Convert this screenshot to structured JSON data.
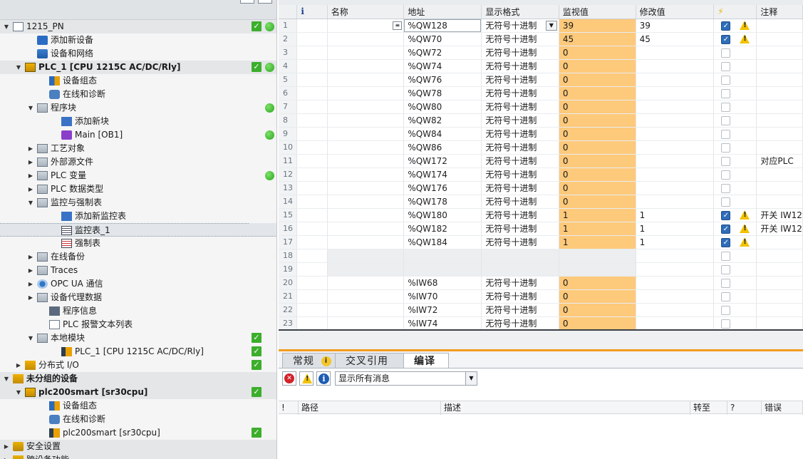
{
  "tree": {
    "rows": [
      {
        "label": "1215_PN",
        "indent": 0,
        "arrow": "down",
        "icon": "project-icon",
        "check": true,
        "dot": true,
        "band": true
      },
      {
        "label": "添加新设备",
        "indent": 2,
        "arrow": "",
        "icon": "add-device-icon"
      },
      {
        "label": "设备和网络",
        "indent": 2,
        "arrow": "",
        "icon": "network-icon"
      },
      {
        "label": "PLC_1 [CPU 1215C AC/DC/Rly]",
        "indent": 1,
        "arrow": "down",
        "icon": "plc-icon",
        "check": true,
        "dot": true,
        "band": true,
        "bold": true
      },
      {
        "label": "设备组态",
        "indent": 3,
        "arrow": "",
        "icon": "device-config-icon"
      },
      {
        "label": "在线和诊断",
        "indent": 3,
        "arrow": "",
        "icon": "online-diagnostics-icon"
      },
      {
        "label": "程序块",
        "indent": 2,
        "arrow": "down",
        "icon": "folder-icon",
        "dot": true
      },
      {
        "label": "添加新块",
        "indent": 4,
        "arrow": "",
        "icon": "add-block-icon"
      },
      {
        "label": "Main [OB1]",
        "indent": 4,
        "arrow": "",
        "icon": "ob-block-icon",
        "dot": true
      },
      {
        "label": "工艺对象",
        "indent": 2,
        "arrow": "right",
        "icon": "folder-icon"
      },
      {
        "label": "外部源文件",
        "indent": 2,
        "arrow": "right",
        "icon": "folder-icon"
      },
      {
        "label": "PLC 变量",
        "indent": 2,
        "arrow": "right",
        "icon": "folder-icon",
        "dot": true
      },
      {
        "label": "PLC 数据类型",
        "indent": 2,
        "arrow": "right",
        "icon": "folder-icon"
      },
      {
        "label": "监控与强制表",
        "indent": 2,
        "arrow": "down",
        "icon": "folder-icon"
      },
      {
        "label": "添加新监控表",
        "indent": 4,
        "arrow": "",
        "icon": "add-watch-table-icon"
      },
      {
        "label": "监控表_1",
        "indent": 4,
        "arrow": "",
        "icon": "watch-table-icon",
        "selected": true
      },
      {
        "label": "强制表",
        "indent": 4,
        "arrow": "",
        "icon": "force-table-icon"
      },
      {
        "label": "在线备份",
        "indent": 2,
        "arrow": "right",
        "icon": "folder-icon"
      },
      {
        "label": "Traces",
        "indent": 2,
        "arrow": "right",
        "icon": "folder-icon"
      },
      {
        "label": "OPC UA 通信",
        "indent": 2,
        "arrow": "right",
        "icon": "opc-ua-icon"
      },
      {
        "label": "设备代理数据",
        "indent": 2,
        "arrow": "right",
        "icon": "folder-icon"
      },
      {
        "label": "程序信息",
        "indent": 3,
        "arrow": "",
        "icon": "program-info-icon"
      },
      {
        "label": "PLC 报警文本列表",
        "indent": 3,
        "arrow": "",
        "icon": "alarm-text-icon"
      },
      {
        "label": "本地模块",
        "indent": 2,
        "arrow": "down",
        "icon": "folder-icon",
        "check": true
      },
      {
        "label": "PLC_1 [CPU 1215C AC/DC/Rly]",
        "indent": 4,
        "arrow": "",
        "icon": "cpu-module-icon",
        "check": true
      },
      {
        "label": "分布式 I/O",
        "indent": 1,
        "arrow": "right",
        "icon": "distributed-io-icon",
        "check": true
      },
      {
        "label": "未分组的设备",
        "indent": 0,
        "arrow": "down",
        "icon": "ungrouped-icon",
        "bold": true,
        "band": true
      },
      {
        "label": "plc200smart [sr30cpu]",
        "indent": 1,
        "arrow": "down",
        "icon": "plc-icon",
        "check": true,
        "bold": true,
        "band": true
      },
      {
        "label": "设备组态",
        "indent": 3,
        "arrow": "",
        "icon": "device-config-icon"
      },
      {
        "label": "在线和诊断",
        "indent": 3,
        "arrow": "",
        "icon": "online-diagnostics-icon"
      },
      {
        "label": "plc200smart [sr30cpu]",
        "indent": 3,
        "arrow": "",
        "icon": "cpu-module-icon",
        "check": true
      },
      {
        "label": "安全设置",
        "indent": 0,
        "arrow": "right",
        "icon": "security-icon",
        "band": true
      },
      {
        "label": "跨设备功能",
        "indent": 0,
        "arrow": "right",
        "icon": "cross-device-icon",
        "band": true
      }
    ]
  },
  "watch": {
    "columns": [
      "",
      "",
      "名称",
      "地址",
      "显示格式",
      "监视值",
      "修改值",
      "",
      "注释"
    ],
    "info_icon": "i",
    "bolt_icon": "⚡",
    "rows": [
      {
        "n": "1",
        "addr": "%QW128",
        "fmt": "无符号十进制",
        "mon": "39",
        "mod": "39",
        "checked": true,
        "warn": true,
        "comment": "",
        "selected": true
      },
      {
        "n": "2",
        "addr": "%QW70",
        "fmt": "无符号十进制",
        "mon": "45",
        "mod": "45",
        "checked": true,
        "warn": true,
        "comment": ""
      },
      {
        "n": "3",
        "addr": "%QW72",
        "fmt": "无符号十进制",
        "mon": "0",
        "mod": "",
        "comment": ""
      },
      {
        "n": "4",
        "addr": "%QW74",
        "fmt": "无符号十进制",
        "mon": "0",
        "mod": "",
        "comment": ""
      },
      {
        "n": "5",
        "addr": "%QW76",
        "fmt": "无符号十进制",
        "mon": "0",
        "mod": "",
        "comment": ""
      },
      {
        "n": "6",
        "addr": "%QW78",
        "fmt": "无符号十进制",
        "mon": "0",
        "mod": "",
        "comment": ""
      },
      {
        "n": "7",
        "addr": "%QW80",
        "fmt": "无符号十进制",
        "mon": "0",
        "mod": "",
        "comment": ""
      },
      {
        "n": "8",
        "addr": "%QW82",
        "fmt": "无符号十进制",
        "mon": "0",
        "mod": "",
        "comment": ""
      },
      {
        "n": "9",
        "addr": "%QW84",
        "fmt": "无符号十进制",
        "mon": "0",
        "mod": "",
        "comment": ""
      },
      {
        "n": "10",
        "addr": "%QW86",
        "fmt": "无符号十进制",
        "mon": "0",
        "mod": "",
        "comment": ""
      },
      {
        "n": "11",
        "addr": "%QW172",
        "fmt": "无符号十进制",
        "mon": "0",
        "mod": "",
        "comment": "对应PLC"
      },
      {
        "n": "12",
        "addr": "%QW174",
        "fmt": "无符号十进制",
        "mon": "0",
        "mod": "",
        "comment": ""
      },
      {
        "n": "13",
        "addr": "%QW176",
        "fmt": "无符号十进制",
        "mon": "0",
        "mod": "",
        "comment": ""
      },
      {
        "n": "14",
        "addr": "%QW178",
        "fmt": "无符号十进制",
        "mon": "0",
        "mod": "",
        "comment": ""
      },
      {
        "n": "15",
        "addr": "%QW180",
        "fmt": "无符号十进制",
        "mon": "1",
        "mod": "1",
        "checked": true,
        "warn": true,
        "comment": "开关 IW12"
      },
      {
        "n": "16",
        "addr": "%QW182",
        "fmt": "无符号十进制",
        "mon": "1",
        "mod": "1",
        "checked": true,
        "warn": true,
        "comment": "开关 IW12"
      },
      {
        "n": "17",
        "addr": "%QW184",
        "fmt": "无符号十进制",
        "mon": "1",
        "mod": "1",
        "checked": true,
        "warn": true,
        "comment": ""
      },
      {
        "n": "18",
        "addr": "",
        "fmt": "",
        "mon": "",
        "mod": "",
        "comment": "",
        "empty": true
      },
      {
        "n": "19",
        "addr": "",
        "fmt": "",
        "mon": "",
        "mod": "",
        "comment": "",
        "empty": true
      },
      {
        "n": "20",
        "addr": "%IW68",
        "fmt": "无符号十进制",
        "mon": "0",
        "mod": "",
        "comment": ""
      },
      {
        "n": "21",
        "addr": "%IW70",
        "fmt": "无符号十进制",
        "mon": "0",
        "mod": "",
        "comment": ""
      },
      {
        "n": "22",
        "addr": "%IW72",
        "fmt": "无符号十进制",
        "mon": "0",
        "mod": "",
        "comment": ""
      },
      {
        "n": "23",
        "addr": "%IW74",
        "fmt": "无符号十进制",
        "mon": "0",
        "mod": "",
        "comment": ""
      }
    ]
  },
  "inspector": {
    "tabs": [
      {
        "label": "常规",
        "badge": "i"
      },
      {
        "label": "交叉引用"
      },
      {
        "label": "编译",
        "active": true
      }
    ],
    "filter_value": "显示所有消息",
    "columns": [
      "!",
      "路径",
      "描述",
      "转至",
      "?",
      "错误"
    ]
  },
  "colors": {
    "monitor_bg": "#fdc97b",
    "check_green": "#3cae2c",
    "accent_orange": "#f29c1f"
  }
}
